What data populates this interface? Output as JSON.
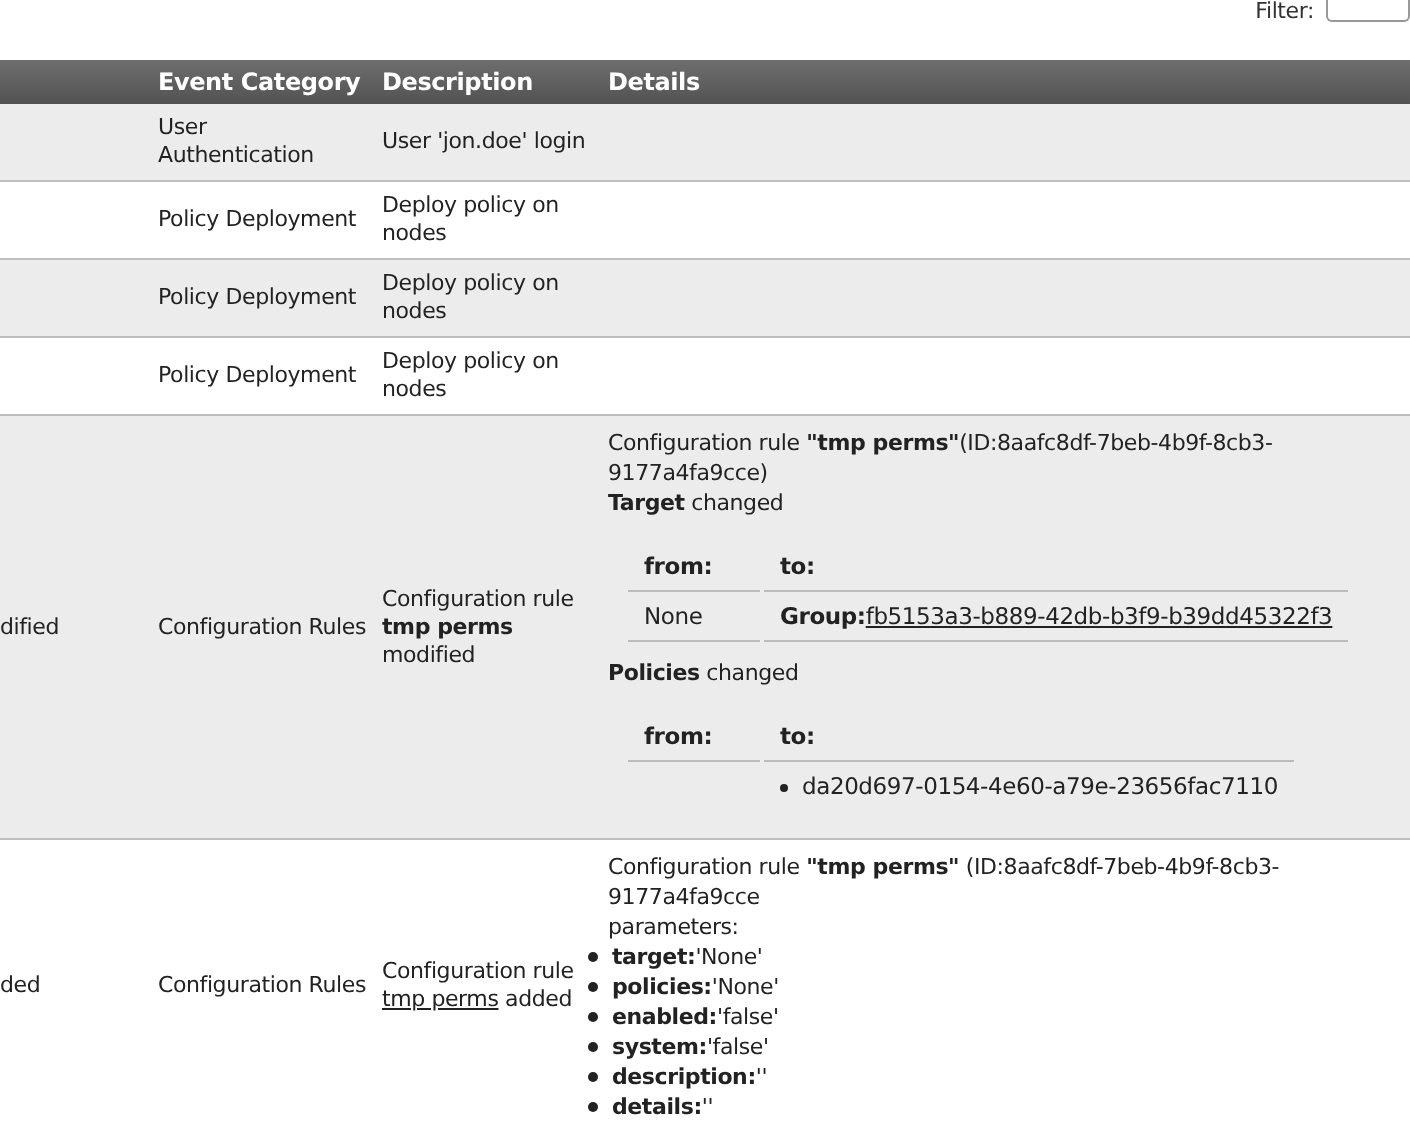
{
  "filter": {
    "label": "Filter:"
  },
  "table": {
    "columns": [
      {},
      {
        "label": "Event Category"
      },
      {
        "label": "Description"
      },
      {
        "label": "Details"
      }
    ],
    "rows": [
      {
        "event_category": "User Authentication",
        "description": {
          "kind": "text",
          "text": "User 'jon.doe' login"
        },
        "details": {
          "kind": "none"
        }
      },
      {
        "event_category": "Policy Deployment",
        "description": {
          "kind": "text",
          "text": "Deploy policy on nodes"
        },
        "details": {
          "kind": "none"
        }
      },
      {
        "event_category": "Policy Deployment",
        "description": {
          "kind": "text",
          "text": "Deploy policy on nodes"
        },
        "details": {
          "kind": "none"
        }
      },
      {
        "event_category": "Policy Deployment",
        "description": {
          "kind": "text",
          "text": "Deploy policy on nodes"
        },
        "details": {
          "kind": "none"
        }
      },
      {
        "column_1": "dified",
        "event_category": "Configuration Rules",
        "description": {
          "kind": "text",
          "text": "Configuration rule **tmp perms** modified"
        },
        "details": {
          "kind": "changes",
          "intro": "Configuration rule **\"tmp perms\"**(ID:8aafc8df-7beb-4b9f-8cb3-9177a4fa9cce)",
          "changes": [
            {
              "title": "**Target** changed",
              "from_header": "from:",
              "to_header": "to:",
              "rows": [
                {
                  "from": "None",
                  "to_label": "Group:",
                  "to_link": "fb5153a3-b889-42db-b3f9-b39dd45322f3"
                }
              ]
            },
            {
              "title": "**Policies** changed",
              "from_header": "from:",
              "to_header": "to:",
              "to_items": [
                "da20d697-0154-4e60-a79e-23656fac7110"
              ]
            }
          ]
        }
      },
      {
        "column_1": "ded",
        "event_category": "Configuration Rules",
        "description": {
          "kind": "link",
          "before": "Configuration rule",
          "link": "tmp perms",
          "after": "added"
        },
        "details": {
          "kind": "params",
          "intro": "Configuration rule **\"tmp perms\"** (ID:8aafc8df-7beb-4b9f-8cb3-9177a4fa9cce",
          "subtitle": "parameters:",
          "params": [
            {
              "key": "target:",
              "value": "'None'"
            },
            {
              "key": "policies:",
              "value": "'None'"
            },
            {
              "key": "enabled:",
              "value": "'false'"
            },
            {
              "key": "system:",
              "value": "'false'"
            },
            {
              "key": "description:",
              "value": "''"
            },
            {
              "key": "details:",
              "value": "''"
            }
          ]
        }
      }
    ]
  }
}
